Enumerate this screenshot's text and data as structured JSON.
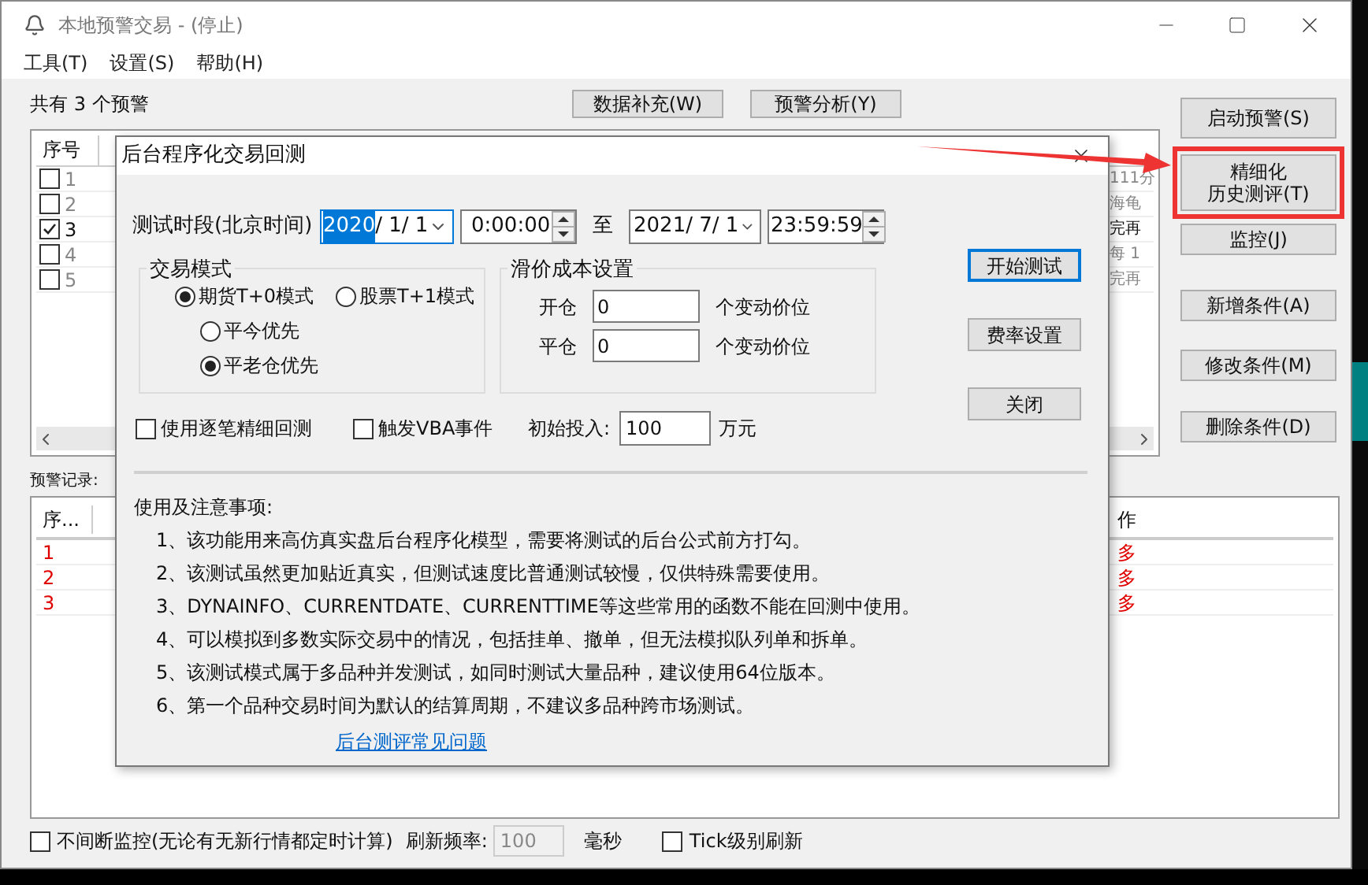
{
  "window": {
    "title": "本地预警交易 - (停止)"
  },
  "menu": [
    {
      "label": "工具(T)"
    },
    {
      "label": "设置(S)"
    },
    {
      "label": "帮助(H)"
    }
  ],
  "summary": "共有 3 个预警",
  "toolbar_buttons": [
    "数据补充(W)",
    "预警分析(Y)"
  ],
  "side_buttons": [
    {
      "lines": [
        "启动预警(S)"
      ],
      "highlighted": false
    },
    {
      "lines": [
        "精细化",
        "历史测评(T)"
      ],
      "highlighted": true
    },
    {
      "lines": [
        "监控(J)"
      ],
      "highlighted": false
    },
    {
      "lines": [
        "新增条件(A)"
      ],
      "highlighted": false
    },
    {
      "lines": [
        "修改条件(M)"
      ],
      "highlighted": false
    },
    {
      "lines": [
        "删除条件(D)"
      ],
      "highlighted": false
    }
  ],
  "alert_list": {
    "columns": [
      "序号"
    ],
    "rows": [
      {
        "checked": false,
        "number": "1",
        "tail": "111分"
      },
      {
        "checked": false,
        "number": "2",
        "tail": "海龟"
      },
      {
        "checked": true,
        "number": "3",
        "tail": "完再"
      },
      {
        "checked": false,
        "number": "4",
        "tail": "每 1"
      },
      {
        "checked": false,
        "number": "5",
        "tail": "完再"
      }
    ]
  },
  "records": {
    "label": "预警记录:",
    "columns": [
      "序...",
      "作"
    ],
    "rows": [
      {
        "cells": [
          "1",
          "多"
        ]
      },
      {
        "cells": [
          "2",
          "多"
        ]
      },
      {
        "cells": [
          "3",
          "多"
        ]
      }
    ]
  },
  "bottom_bar": {
    "continuous": {
      "label": "不间断监控(无论有无新行情都定时计算)",
      "checked": false
    },
    "refresh_label": "刷新频率:",
    "refresh_value": "100",
    "refresh_disabled": true,
    "unit": "毫秒",
    "tick": {
      "label": "Tick级别刷新",
      "checked": false
    }
  },
  "dialog": {
    "title": "后台程序化交易回测",
    "period_label": "测试时段(北京时间)",
    "start_date": {
      "year": "2020",
      "rest": "/ 1/ 1"
    },
    "start_time": "0:00:00",
    "to": "至",
    "end_date": "2021/ 7/ 1",
    "end_time": "23:59:59",
    "mode_group": {
      "title": "交易模式",
      "options": [
        {
          "label": "期货T+0模式",
          "selected": true
        },
        {
          "label": "股票T+1模式",
          "selected": false
        }
      ],
      "sub_options": [
        {
          "label": "平今优先",
          "selected": false
        },
        {
          "label": "平老仓优先",
          "selected": true
        }
      ]
    },
    "slippage_group": {
      "title": "滑价成本设置",
      "rows": [
        {
          "label": "开仓",
          "value": "0",
          "unit": "个变动价位"
        },
        {
          "label": "平仓",
          "value": "0",
          "unit": "个变动价位"
        }
      ]
    },
    "buttons": [
      {
        "label": "开始测试",
        "default": true
      },
      {
        "label": "费率设置",
        "default": false
      },
      {
        "label": "关闭",
        "default": false
      }
    ],
    "tick_backtest": {
      "label": "使用逐笔精细回测",
      "checked": false
    },
    "vba_events": {
      "label": "触发VBA事件",
      "checked": false
    },
    "capital_label": "初始投入:",
    "capital_value": "100",
    "capital_unit": "万元",
    "notes_title": "使用及注意事项:",
    "notes": [
      "1、该功能用来高仿真实盘后台程序化模型，需要将测试的后台公式前方打勾。",
      "2、该测试虽然更加贴近真实，但测试速度比普通测试较慢，仅供特殊需要使用。",
      "3、DYNAINFO、CURRENTDATE、CURRENTTIME等这些常用的函数不能在回测中使用。",
      "4、可以模拟到多数实际交易中的情况，包括挂单、撤单，但无法模拟队列单和拆单。",
      "5、该测试模式属于多品种并发测试，如同时测试大量品种，建议使用64位版本。",
      "6、第一个品种交易时间为默认的结算周期，不建议多品种跨市场测试。"
    ],
    "faq_link": "后台测评常见问题"
  }
}
